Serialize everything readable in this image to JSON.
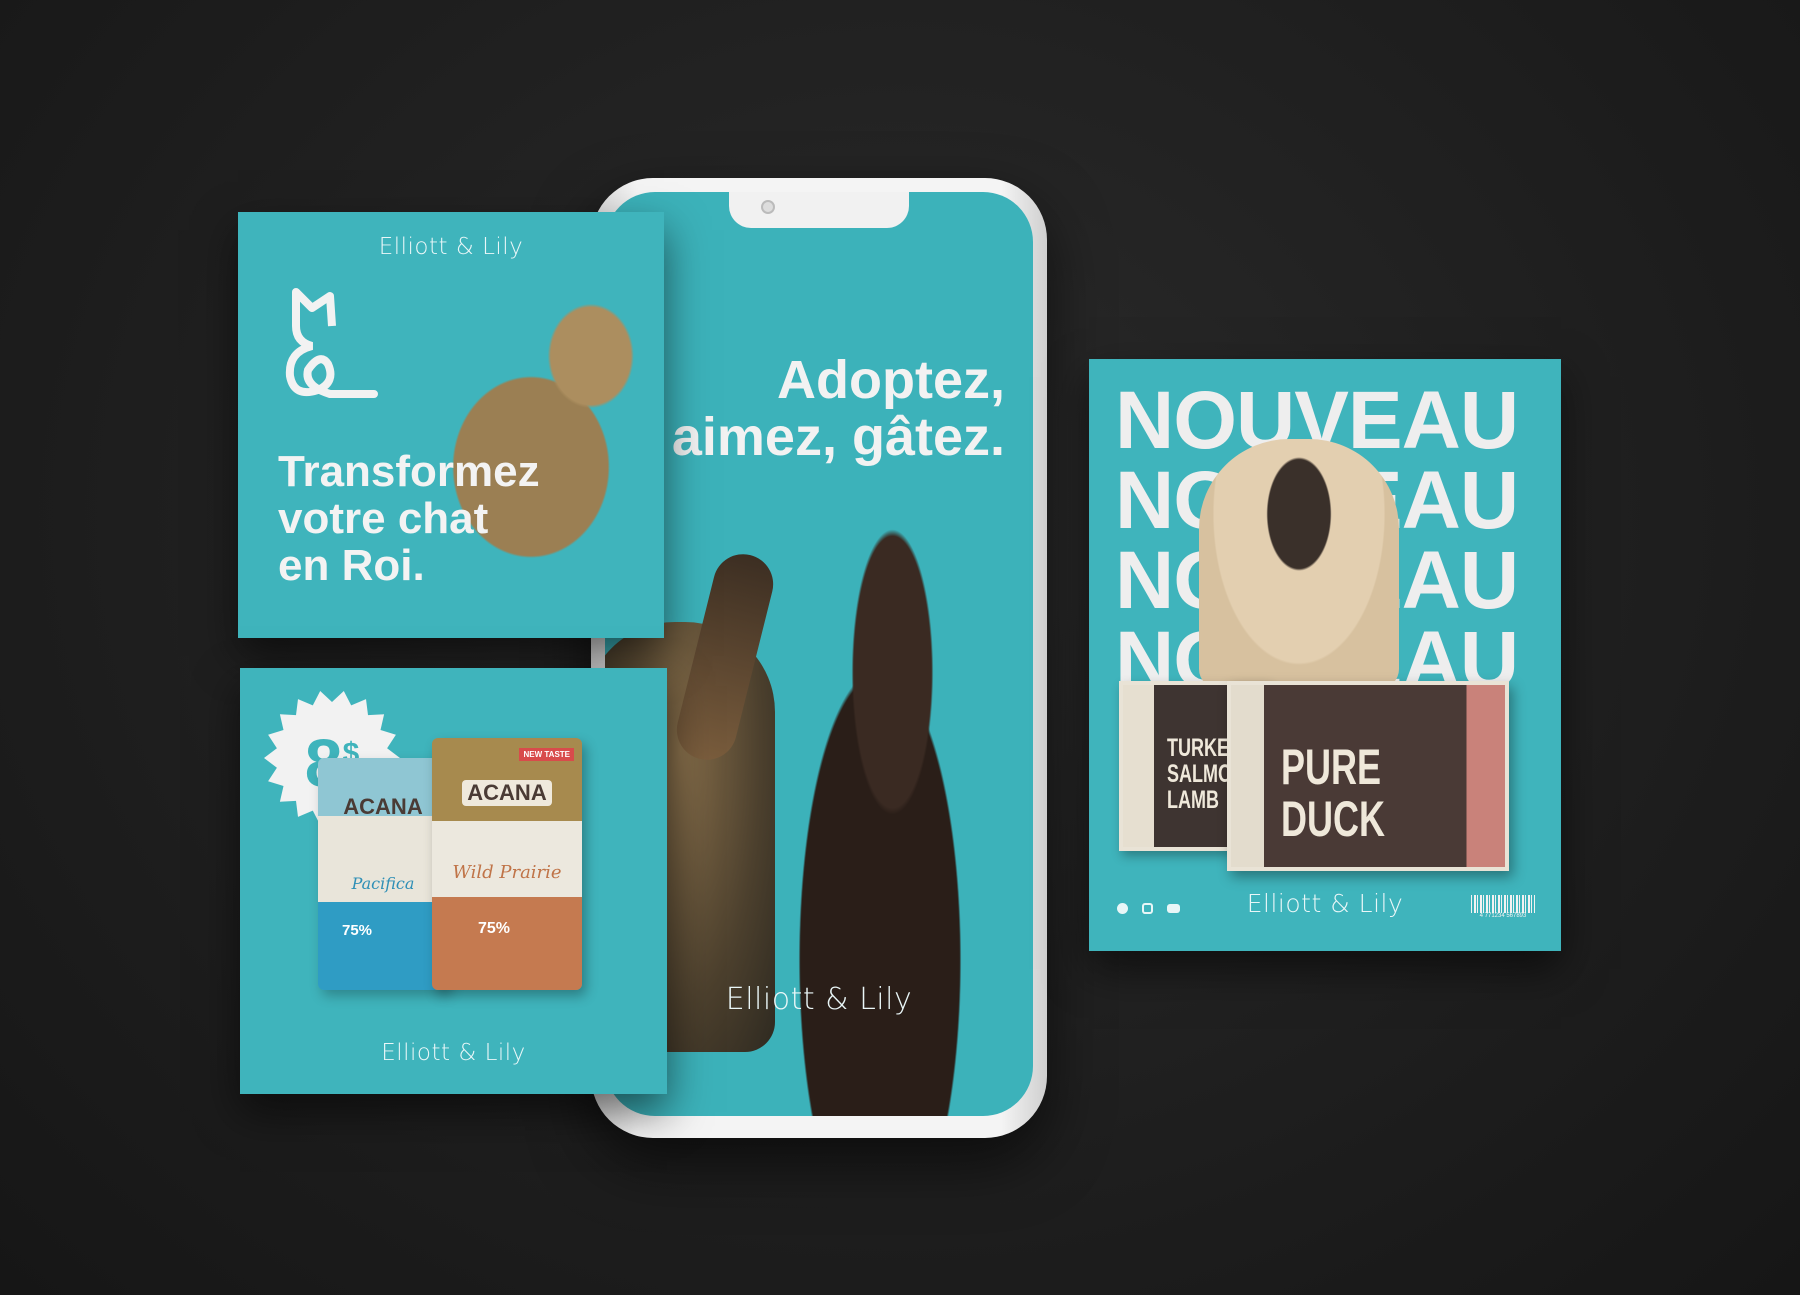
{
  "brand": "Elliott & Lily",
  "phone": {
    "headline_line1": "Adoptez,",
    "headline_line2": "aimez, gâtez.",
    "brand": "Elliott & Lily"
  },
  "cat_card": {
    "brand": "Elliott & Lily",
    "headline": [
      "Transformez",
      "votre chat",
      "en Roi."
    ]
  },
  "price_card": {
    "price": "8",
    "currency": "$",
    "brand": "Elliott & Lily",
    "products": [
      {
        "brand": "ACANA",
        "name": "Pacifica",
        "stat": "75%"
      },
      {
        "brand": "ACANA",
        "name": "Wild Prairie",
        "stat": "75%",
        "tag": "NEW TASTE"
      }
    ]
  },
  "new_card": {
    "repeat_word": "NOUVEAU",
    "products": [
      {
        "name": [
          "TURKEY",
          "SALMON",
          "LAMB"
        ]
      },
      {
        "name": [
          "PURE",
          "DUCK"
        ]
      }
    ],
    "brand": "Elliott & Lily",
    "barcode": "4 771234 567893",
    "social": [
      "facebook",
      "instagram",
      "youtube"
    ]
  },
  "colors": {
    "teal": "#3fb4bc",
    "background": "#1e1e1e"
  }
}
